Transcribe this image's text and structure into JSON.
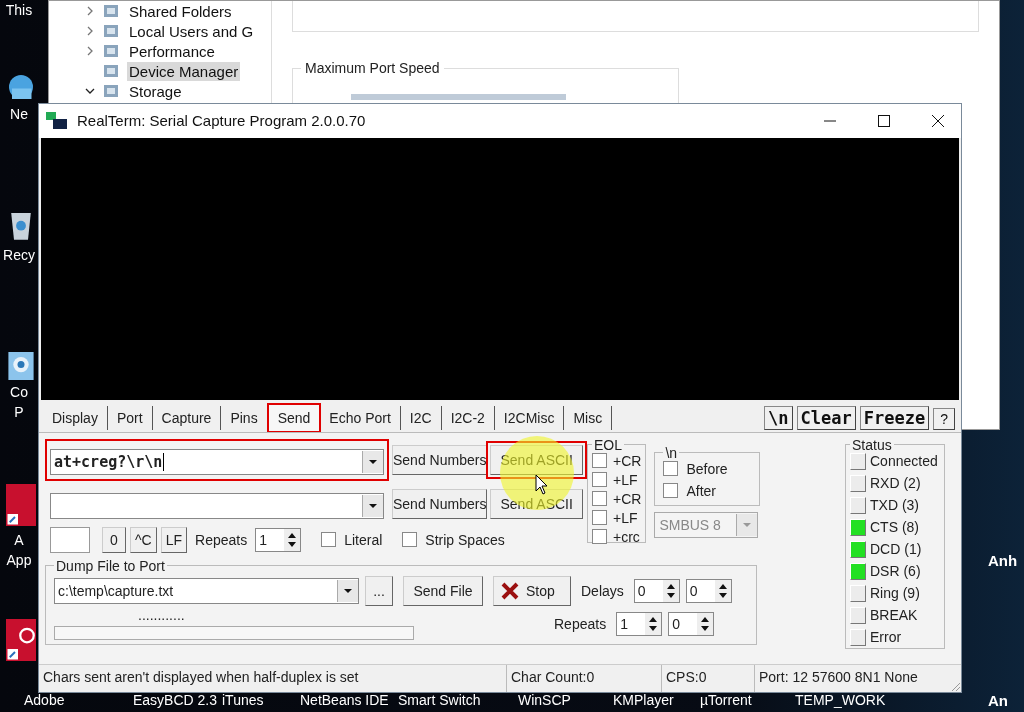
{
  "desktop": {
    "left_icons": [
      {
        "kind": "pc",
        "lines": [
          "This"
        ]
      },
      {
        "kind": "network",
        "lines": [
          "Ne"
        ]
      },
      {
        "kind": "recycle",
        "lines": [
          "Recy"
        ]
      },
      {
        "kind": "control",
        "lines": [
          "Co",
          "P"
        ]
      },
      {
        "kind": "acrobat",
        "lines": [
          "A",
          "App"
        ]
      },
      {
        "kind": "adobe"
      }
    ],
    "bottom_labels": [
      "Adobe",
      "EasyBCD 2.3",
      "iTunes",
      "NetBeans IDE",
      "Smart Switch",
      "WinSCP",
      "KMPlayer",
      "µTorrent",
      "TEMP_WORK"
    ],
    "right_labels": [
      "Anh",
      "An"
    ]
  },
  "background_window": {
    "tree": [
      {
        "label": "Shared Folders",
        "has_children": true,
        "expanded": false,
        "selected": false
      },
      {
        "label": "Local Users and G",
        "has_children": true,
        "expanded": false,
        "selected": false
      },
      {
        "label": "Performance",
        "has_children": true,
        "expanded": false,
        "selected": false
      },
      {
        "label": "Device Manager",
        "has_children": false,
        "expanded": false,
        "selected": true
      },
      {
        "label": "Storage",
        "has_children": true,
        "expanded": true,
        "selected": false
      }
    ],
    "group_title": "Maximum Port Speed"
  },
  "realterm": {
    "title": "RealTerm: Serial Capture Program 2.0.0.70",
    "tabs": [
      {
        "label": "Display",
        "selected": false,
        "highlighted": false
      },
      {
        "label": "Port",
        "selected": false,
        "highlighted": false
      },
      {
        "label": "Capture",
        "selected": false,
        "highlighted": false
      },
      {
        "label": "Pins",
        "selected": false,
        "highlighted": false
      },
      {
        "label": "Send",
        "selected": true,
        "highlighted": true
      },
      {
        "label": "Echo Port",
        "selected": false,
        "highlighted": false
      },
      {
        "label": "I2C",
        "selected": false,
        "highlighted": false
      },
      {
        "label": "I2C-2",
        "selected": false,
        "highlighted": false
      },
      {
        "label": "I2CMisc",
        "selected": false,
        "highlighted": false
      },
      {
        "label": "Misc",
        "selected": false,
        "highlighted": false
      }
    ],
    "tool_buttons": [
      "\\n",
      "Clear",
      "Freeze",
      "?"
    ],
    "send_rows": [
      {
        "value": "at+creg?\\r\\n",
        "highlighted": true,
        "buttons": [
          {
            "label": "Send Numbers",
            "highlighted": false
          },
          {
            "label": "Send ASCII",
            "highlighted": true
          }
        ]
      },
      {
        "highlighted": false,
        "buttons": [
          {
            "label": "Send Numbers",
            "highlighted": false
          },
          {
            "label": "Send ASCII",
            "highlighted": false
          }
        ]
      }
    ],
    "control_buttons": [
      "0",
      "^C",
      "LF"
    ],
    "repeats": {
      "label": "Repeats",
      "value": "1"
    },
    "options": [
      {
        "label": "Literal",
        "checked": false
      },
      {
        "label": "Strip Spaces",
        "checked": false
      }
    ],
    "eol": {
      "title": "EOL",
      "options": [
        {
          "label": "+CR",
          "checked": false
        },
        {
          "label": "+LF",
          "checked": false
        },
        {
          "label": "+CR",
          "checked": false
        },
        {
          "label": "+LF",
          "checked": false
        },
        {
          "label": "+crc",
          "checked": false
        }
      ]
    },
    "newline": {
      "title": "\\n",
      "options": [
        {
          "label": "Before",
          "checked": false
        },
        {
          "label": "After",
          "checked": false
        }
      ],
      "dropdown": {
        "value": "SMBUS 8",
        "disabled": true
      }
    },
    "dump": {
      "title": "Dump File to Port",
      "file": "c:\\temp\\capture.txt",
      "browse": "...",
      "send_file": "Send File",
      "stop": "Stop",
      "progress_text": "............",
      "level": 0,
      "delays": {
        "label": "Delays",
        "values": [
          "0",
          "0"
        ]
      },
      "repeats": {
        "label": "Repeats",
        "values": [
          "1",
          "0"
        ]
      }
    },
    "status": {
      "title": "Status",
      "items": [
        {
          "label": "Connected",
          "on": false
        },
        {
          "label": "RXD (2)",
          "on": false
        },
        {
          "label": "TXD (3)",
          "on": false
        },
        {
          "label": "CTS (8)",
          "on": true
        },
        {
          "label": "DCD (1)",
          "on": true
        },
        {
          "label": "DSR (6)",
          "on": true
        },
        {
          "label": "Ring (9)",
          "on": false
        },
        {
          "label": "BREAK",
          "on": false
        },
        {
          "label": "Error",
          "on": false
        }
      ]
    },
    "status_bar": [
      "Chars sent aren't displayed when half-duplex is set",
      "Char Count:0",
      "CPS:0",
      "Port: 12 57600 8N1 None"
    ]
  }
}
